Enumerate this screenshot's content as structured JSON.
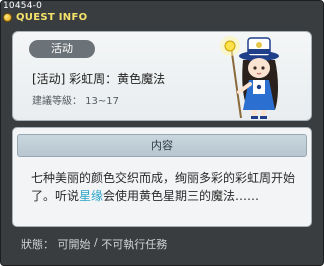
{
  "header": {
    "quest_id": "10454-0",
    "title": "QUEST INFO",
    "title_icon": "quest-coin-icon"
  },
  "summary": {
    "category_badge": "活动",
    "quest_name": "[活动] 彩虹周：黄色魔法",
    "recommended_level": "建議等級： 13~17",
    "npc_icon": "npc-lamp-girl-icon"
  },
  "content": {
    "header": "内容",
    "text_part1": "七种美丽的颜色交织而成，绚丽多彩的彩虹周开始了。听说",
    "text_highlight": "星缘",
    "text_part2": "会使用黄色星期三的魔法……"
  },
  "status": {
    "label": "狀態： ",
    "value": "可開始",
    "separator": " / ",
    "note": "不可執行任務"
  },
  "colors": {
    "title_accent": "#f6e36b",
    "highlight": "#2aa4c9"
  }
}
